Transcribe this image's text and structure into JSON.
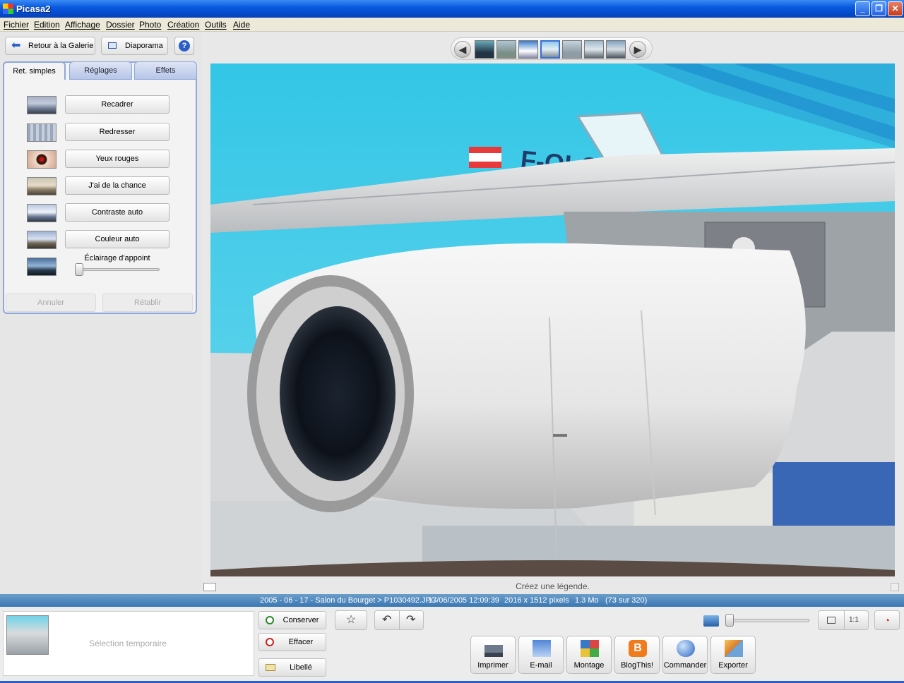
{
  "window": {
    "title": "Picasa2"
  },
  "menu": [
    "Fichier",
    "Edition",
    "Affichage",
    "Dossier",
    "Photo",
    "Création",
    "Outils",
    "Aide"
  ],
  "toolbar": {
    "back_label": "Retour à la Galerie",
    "slideshow_label": "Diaporama",
    "help_label": "?"
  },
  "tabs": [
    {
      "label": "Ret. simples"
    },
    {
      "label": "Réglages"
    },
    {
      "label": "Effets"
    }
  ],
  "fixes": [
    {
      "label": "Recadrer",
      "icon": "crop-icon"
    },
    {
      "label": "Redresser",
      "icon": "straighten-icon"
    },
    {
      "label": "Yeux rouges",
      "icon": "red-eye-icon"
    },
    {
      "label": "J'ai de la chance",
      "icon": "lucky-icon"
    },
    {
      "label": "Contraste auto",
      "icon": "auto-contrast-icon"
    },
    {
      "label": "Couleur auto",
      "icon": "auto-color-icon"
    }
  ],
  "fill_light": {
    "label": "Éclairage d'appoint",
    "value": 0
  },
  "undo_label": "Annuler",
  "redo_label": "Rétablir",
  "filmstrip": {
    "thumbnail_count": 7,
    "selected_index": 3
  },
  "caption_placeholder": "Créez une légende.",
  "info": {
    "path": "2005 - 06 - 17 - Salon du Bourget > P1030492.JPG",
    "datetime": "17/06/2005 12:09:39",
    "dimensions": "2016 x 1512 pixels",
    "size": "1.3 Mo",
    "position": "(73 sur 320)"
  },
  "tray": {
    "label": "Sélection temporaire"
  },
  "tray_buttons": {
    "keep": "Conserver",
    "clear": "Effacer",
    "label": "Libellé"
  },
  "view_buttons": {
    "one_to_one": "1:1"
  },
  "zoom": {
    "value": 0
  },
  "actions": [
    {
      "label": "Imprimer",
      "icon": "printer-icon"
    },
    {
      "label": "E-mail",
      "icon": "email-icon"
    },
    {
      "label": "Montage",
      "icon": "collage-icon"
    },
    {
      "label": "BlogThis!",
      "icon": "blogger-icon"
    },
    {
      "label": "Commander",
      "icon": "order-prints-icon"
    },
    {
      "label": "Exporter",
      "icon": "export-icon"
    }
  ],
  "colors": {
    "titlebar": "#0a5ae0",
    "infobar": "#4a86bf",
    "tab_border": "#8ea8dc",
    "sky": "#6fd9ee",
    "fuselage": "#3ccbe8"
  }
}
